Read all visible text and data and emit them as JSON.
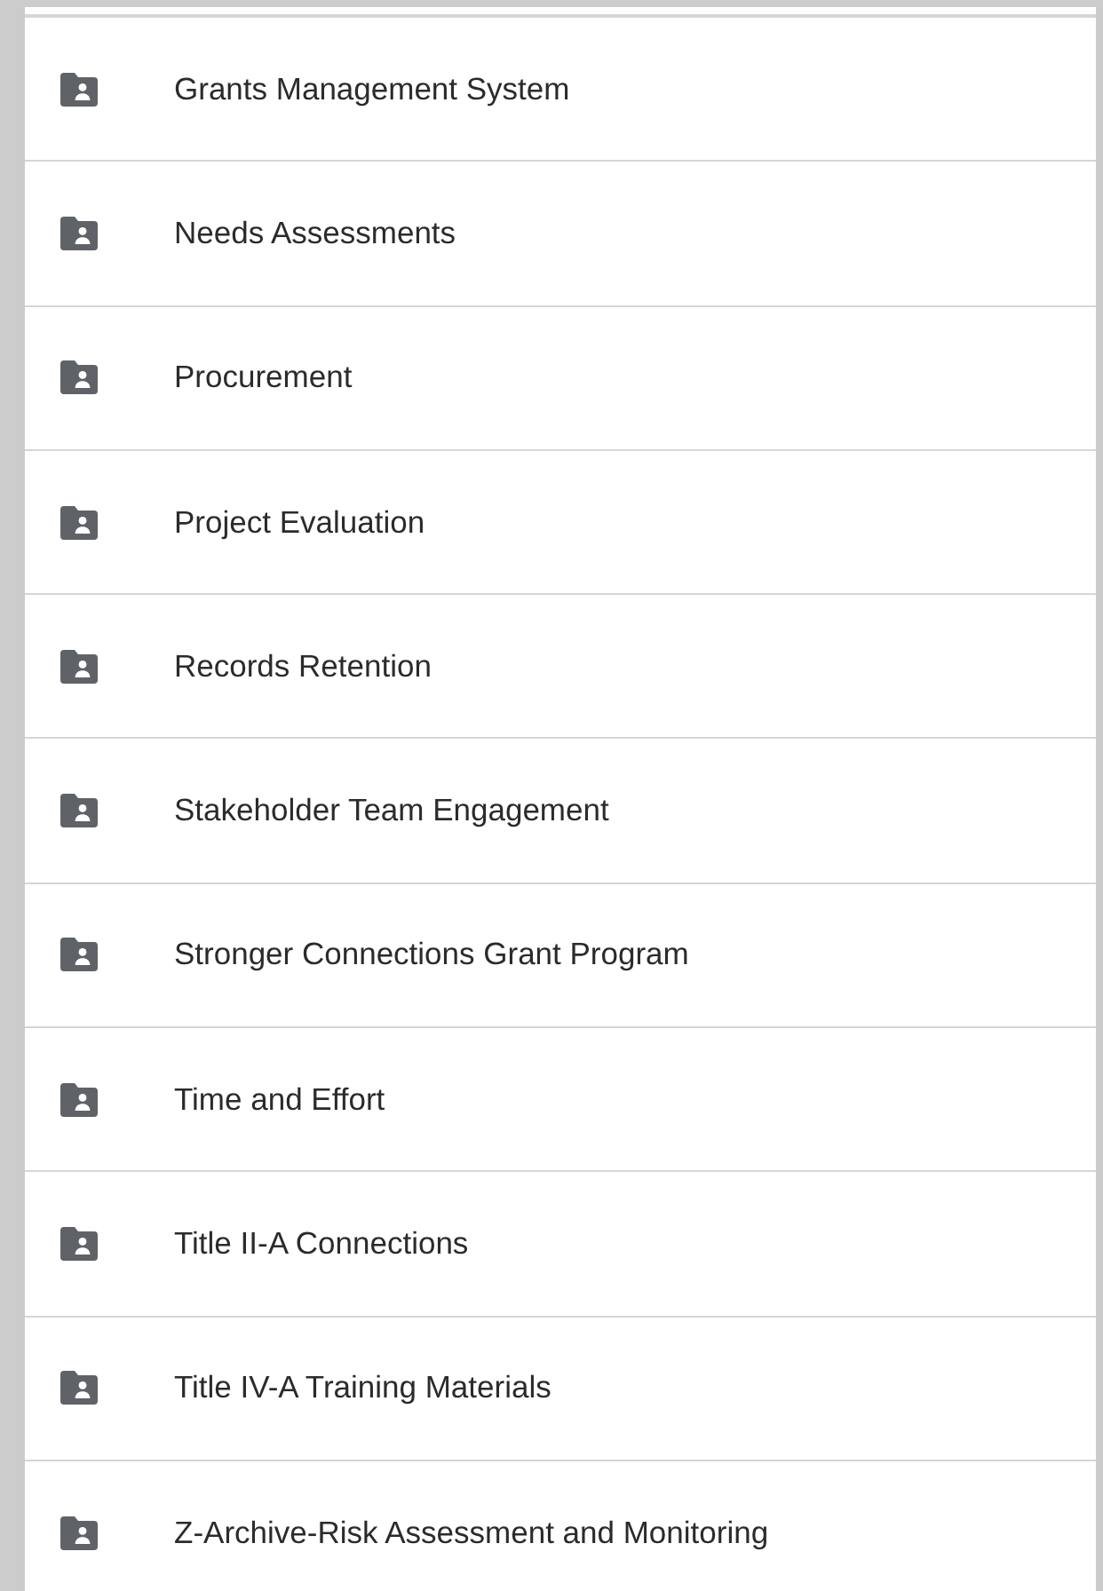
{
  "folders": [
    {
      "name": "Grants Management System"
    },
    {
      "name": "Needs Assessments"
    },
    {
      "name": "Procurement"
    },
    {
      "name": "Project Evaluation"
    },
    {
      "name": "Records Retention"
    },
    {
      "name": "Stakeholder Team Engagement"
    },
    {
      "name": "Stronger Connections Grant Program"
    },
    {
      "name": "Time and Effort"
    },
    {
      "name": "Title II-A Connections"
    },
    {
      "name": "Title IV-A Training Materials"
    },
    {
      "name": "Z-Archive-Risk Assessment and Monitoring"
    }
  ]
}
